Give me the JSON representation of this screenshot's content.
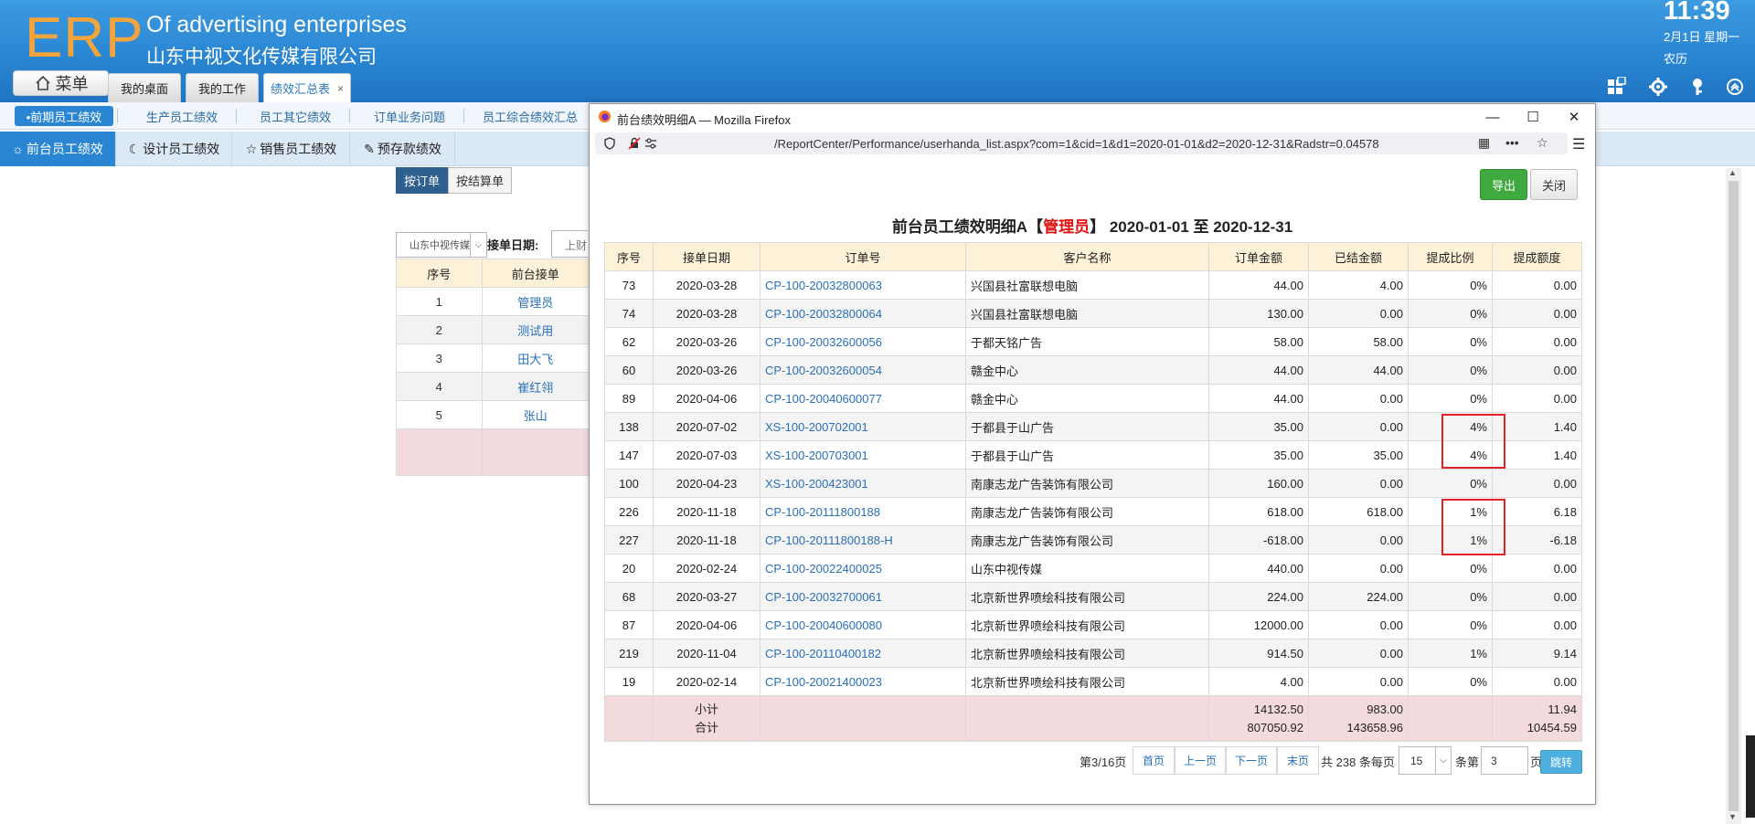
{
  "header": {
    "logo": "ERP",
    "company_en": "Of advertising enterprises",
    "company_cn": "山东中视文化传媒有限公司",
    "time": "11:39",
    "date": "2月1日 星期一",
    "lunar": "农历",
    "menu_label": "菜单",
    "tabs": [
      {
        "label": "我的桌面"
      },
      {
        "label": "我的工作"
      },
      {
        "label": "绩效汇总表",
        "close": "×"
      }
    ],
    "icons": [
      "grid-icon",
      "gear-icon",
      "key-icon",
      "collapse-icon"
    ]
  },
  "subtabs": [
    "•前期员工绩效",
    "生产员工绩效",
    "员工其它绩效",
    "订单业务问题",
    "员工综合绩效汇总"
  ],
  "toolbar2": [
    {
      "icon": "☼",
      "label": "前台员工绩效"
    },
    {
      "icon": "☾",
      "label": "设计员工绩效"
    },
    {
      "icon": "☆",
      "label": "销售员工绩效"
    },
    {
      "icon": "✎",
      "label": "预存款绩效"
    }
  ],
  "background_page": {
    "btn_by_order": "按订单",
    "btn_by_settle": "按结算单",
    "company_select": "山东中视传媒",
    "date_label": "接单日期:",
    "date_value": "上财",
    "headers": [
      "序号",
      "前台接单"
    ],
    "rows": [
      {
        "no": "1",
        "name": "管理员"
      },
      {
        "no": "2",
        "name": "测试用"
      },
      {
        "no": "3",
        "name": "田大飞"
      },
      {
        "no": "4",
        "name": "崔红翎"
      },
      {
        "no": "5",
        "name": "张山"
      }
    ]
  },
  "popup": {
    "title": "前台绩效明细A — Mozilla Firefox",
    "url": "/ReportCenter/Performance/userhanda_list.aspx?com=1&cid=1&d1=2020-01-01&d2=2020-12-31&Radstr=0.04578",
    "export_label": "导出",
    "close_label": "关闭",
    "report_title_prefix": "前台员工绩效明细A【",
    "report_title_user": "管理员",
    "report_title_suffix": "】 2020-01-01 至 2020-12-31",
    "headers": [
      "序号",
      "接单日期",
      "订单号",
      "客户名称",
      "订单金额",
      "已结金额",
      "提成比例",
      "提成额度"
    ],
    "rows": [
      {
        "no": "73",
        "date": "2020-03-28",
        "order": "CP-100-20032800063",
        "customer": "兴国县社富联想电脑",
        "amount": "44.00",
        "settled": "4.00",
        "rate": "0%",
        "commission": "0.00"
      },
      {
        "no": "74",
        "date": "2020-03-28",
        "order": "CP-100-20032800064",
        "customer": "兴国县社富联想电脑",
        "amount": "130.00",
        "settled": "0.00",
        "rate": "0%",
        "commission": "0.00"
      },
      {
        "no": "62",
        "date": "2020-03-26",
        "order": "CP-100-20032600056",
        "customer": "于都天铭广告",
        "amount": "58.00",
        "settled": "58.00",
        "rate": "0%",
        "commission": "0.00"
      },
      {
        "no": "60",
        "date": "2020-03-26",
        "order": "CP-100-20032600054",
        "customer": "赣金中心",
        "amount": "44.00",
        "settled": "44.00",
        "rate": "0%",
        "commission": "0.00"
      },
      {
        "no": "89",
        "date": "2020-04-06",
        "order": "CP-100-20040600077",
        "customer": "赣金中心",
        "amount": "44.00",
        "settled": "0.00",
        "rate": "0%",
        "commission": "0.00"
      },
      {
        "no": "138",
        "date": "2020-07-02",
        "order": "XS-100-200702001",
        "customer": "于都县于山广告",
        "amount": "35.00",
        "settled": "0.00",
        "rate": "4%",
        "commission": "1.40"
      },
      {
        "no": "147",
        "date": "2020-07-03",
        "order": "XS-100-200703001",
        "customer": "于都县于山广告",
        "amount": "35.00",
        "settled": "35.00",
        "rate": "4%",
        "commission": "1.40"
      },
      {
        "no": "100",
        "date": "2020-04-23",
        "order": "XS-100-200423001",
        "customer": "南康志龙广告装饰有限公司",
        "amount": "160.00",
        "settled": "0.00",
        "rate": "0%",
        "commission": "0.00"
      },
      {
        "no": "226",
        "date": "2020-11-18",
        "order": "CP-100-20111800188",
        "customer": "南康志龙广告装饰有限公司",
        "amount": "618.00",
        "settled": "618.00",
        "rate": "1%",
        "commission": "6.18"
      },
      {
        "no": "227",
        "date": "2020-11-18",
        "order": "CP-100-20111800188-H",
        "customer": "南康志龙广告装饰有限公司",
        "amount": "-618.00",
        "settled": "0.00",
        "rate": "1%",
        "commission": "-6.18"
      },
      {
        "no": "20",
        "date": "2020-02-24",
        "order": "CP-100-20022400025",
        "customer": "山东中视传媒",
        "amount": "440.00",
        "settled": "0.00",
        "rate": "0%",
        "commission": "0.00"
      },
      {
        "no": "68",
        "date": "2020-03-27",
        "order": "CP-100-20032700061",
        "customer": "北京新世界喷绘科技有限公司",
        "amount": "224.00",
        "settled": "224.00",
        "rate": "0%",
        "commission": "0.00"
      },
      {
        "no": "87",
        "date": "2020-04-06",
        "order": "CP-100-20040600080",
        "customer": "北京新世界喷绘科技有限公司",
        "amount": "12000.00",
        "settled": "0.00",
        "rate": "0%",
        "commission": "0.00"
      },
      {
        "no": "219",
        "date": "2020-11-04",
        "order": "CP-100-20110400182",
        "customer": "北京新世界喷绘科技有限公司",
        "amount": "914.50",
        "settled": "0.00",
        "rate": "1%",
        "commission": "9.14"
      },
      {
        "no": "19",
        "date": "2020-02-14",
        "order": "CP-100-20021400023",
        "customer": "北京新世界喷绘科技有限公司",
        "amount": "4.00",
        "settled": "0.00",
        "rate": "0%",
        "commission": "0.00"
      }
    ],
    "summary": {
      "subtotal_label": "小计",
      "total_label": "合计",
      "subtotal_amount": "14132.50",
      "total_amount": "807050.92",
      "subtotal_settled": "983.00",
      "total_settled": "143658.96",
      "subtotal_commission": "11.94",
      "total_commission": "10454.59"
    },
    "pager": {
      "page_info": "第3/16页",
      "first": "首页",
      "prev": "上一页",
      "next": "下一页",
      "last": "末页",
      "total_text": "共 238 条每页",
      "page_size": "15",
      "per_text": "条第",
      "page_input": "3",
      "page_text": "页",
      "jump": "跳转"
    }
  }
}
